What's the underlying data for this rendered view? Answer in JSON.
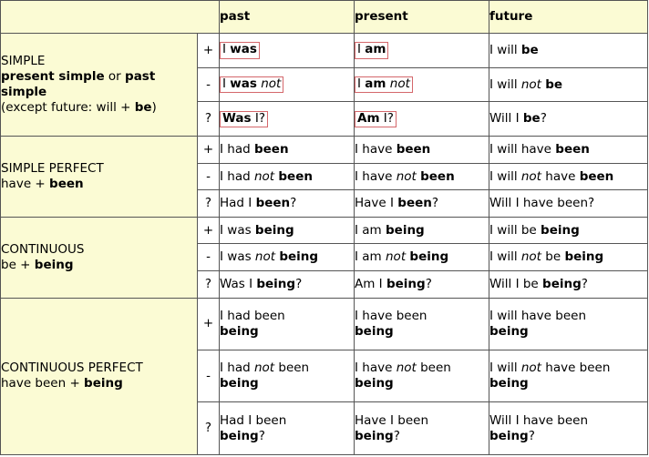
{
  "table": {
    "headers": {
      "blank": "",
      "past": "past",
      "present": "present",
      "future": "future"
    },
    "signs": {
      "positive": "+",
      "negative": "-",
      "question": "?"
    },
    "colors": {
      "header_bg": "#fbfbd4",
      "header_border": "#8a8a4a",
      "label_bg": "#fbfbd4",
      "cell_bg": "#ffffff",
      "grid_border": "#555555",
      "outer_border": "#2b2b2b",
      "highlight_box": "#d4676b",
      "text": "#000000"
    },
    "groups": [
      {
        "title": "SIMPLE",
        "subtitle_parts": [
          {
            "text": "present simple",
            "bold": true
          },
          {
            "text": " or ",
            "bold": false
          },
          {
            "text": "past simple",
            "bold": true
          }
        ],
        "note_parts": [
          {
            "text": "(except future: will + ",
            "bold": false
          },
          {
            "text": "be",
            "bold": true
          },
          {
            "text": ")",
            "bold": false
          }
        ],
        "rows": [
          {
            "sign": "+",
            "past": {
              "boxed": true,
              "parts": [
                {
                  "text": "I ",
                  "bold": false
                },
                {
                  "text": "was",
                  "bold": true
                }
              ]
            },
            "present": {
              "boxed": true,
              "parts": [
                {
                  "text": "I ",
                  "bold": false
                },
                {
                  "text": "am",
                  "bold": true
                }
              ]
            },
            "future": {
              "boxed": false,
              "parts": [
                {
                  "text": "I will ",
                  "bold": false
                },
                {
                  "text": "be",
                  "bold": true
                }
              ]
            }
          },
          {
            "sign": "-",
            "past": {
              "boxed": true,
              "parts": [
                {
                  "text": "I ",
                  "bold": false
                },
                {
                  "text": "was",
                  "bold": true
                },
                {
                  "text": " not",
                  "italic": true
                }
              ]
            },
            "present": {
              "boxed": true,
              "parts": [
                {
                  "text": "I ",
                  "bold": false
                },
                {
                  "text": "am",
                  "bold": true
                },
                {
                  "text": " not",
                  "italic": true
                }
              ]
            },
            "future": {
              "boxed": false,
              "parts": [
                {
                  "text": "I will ",
                  "bold": false
                },
                {
                  "text": "not",
                  "italic": true
                },
                {
                  "text": " ",
                  "bold": false
                },
                {
                  "text": "be",
                  "bold": true
                }
              ]
            }
          },
          {
            "sign": "?",
            "past": {
              "boxed": true,
              "parts": [
                {
                  "text": "Was",
                  "bold": true
                },
                {
                  "text": " I?",
                  "bold": false
                }
              ]
            },
            "present": {
              "boxed": true,
              "parts": [
                {
                  "text": "Am",
                  "bold": true
                },
                {
                  "text": " I?",
                  "bold": false
                }
              ]
            },
            "future": {
              "boxed": false,
              "parts": [
                {
                  "text": "Will I ",
                  "bold": false
                },
                {
                  "text": "be",
                  "bold": true
                },
                {
                  "text": "?",
                  "bold": false
                }
              ]
            }
          }
        ]
      },
      {
        "title": "SIMPLE PERFECT",
        "subtitle_parts": [
          {
            "text": "have + ",
            "bold": false
          },
          {
            "text": "been",
            "bold": true
          }
        ],
        "note_parts": [],
        "rows": [
          {
            "sign": "+",
            "past": {
              "boxed": false,
              "parts": [
                {
                  "text": "I had ",
                  "bold": false
                },
                {
                  "text": "been",
                  "bold": true
                }
              ]
            },
            "present": {
              "boxed": false,
              "parts": [
                {
                  "text": "I have ",
                  "bold": false
                },
                {
                  "text": "been",
                  "bold": true
                }
              ]
            },
            "future": {
              "boxed": false,
              "parts": [
                {
                  "text": "I will have ",
                  "bold": false
                },
                {
                  "text": "been",
                  "bold": true
                }
              ]
            }
          },
          {
            "sign": "-",
            "past": {
              "boxed": false,
              "parts": [
                {
                  "text": "I had ",
                  "bold": false
                },
                {
                  "text": "not",
                  "italic": true
                },
                {
                  "text": " ",
                  "bold": false
                },
                {
                  "text": "been",
                  "bold": true
                }
              ]
            },
            "present": {
              "boxed": false,
              "parts": [
                {
                  "text": "I have ",
                  "bold": false
                },
                {
                  "text": "not",
                  "italic": true
                },
                {
                  "text": " ",
                  "bold": false
                },
                {
                  "text": "been",
                  "bold": true
                }
              ]
            },
            "future": {
              "boxed": false,
              "parts": [
                {
                  "text": "I will ",
                  "bold": false
                },
                {
                  "text": "not",
                  "italic": true
                },
                {
                  "text": " have ",
                  "bold": false
                },
                {
                  "text": "been",
                  "bold": true
                }
              ]
            }
          },
          {
            "sign": "?",
            "past": {
              "boxed": false,
              "parts": [
                {
                  "text": "Had I ",
                  "bold": false
                },
                {
                  "text": "been",
                  "bold": true
                },
                {
                  "text": "?",
                  "bold": false
                }
              ]
            },
            "present": {
              "boxed": false,
              "parts": [
                {
                  "text": "Have I ",
                  "bold": false
                },
                {
                  "text": "been",
                  "bold": true
                },
                {
                  "text": "?",
                  "bold": false
                }
              ]
            },
            "future": {
              "boxed": false,
              "parts": [
                {
                  "text": "Will I have been?",
                  "bold": false
                }
              ]
            }
          }
        ]
      },
      {
        "title": "CONTINUOUS",
        "subtitle_parts": [
          {
            "text": "be + ",
            "bold": false
          },
          {
            "text": "being",
            "bold": true
          }
        ],
        "note_parts": [],
        "rows": [
          {
            "sign": "+",
            "past": {
              "boxed": false,
              "parts": [
                {
                  "text": "I was ",
                  "bold": false
                },
                {
                  "text": "being",
                  "bold": true
                }
              ]
            },
            "present": {
              "boxed": false,
              "parts": [
                {
                  "text": "I am ",
                  "bold": false
                },
                {
                  "text": "being",
                  "bold": true
                }
              ]
            },
            "future": {
              "boxed": false,
              "parts": [
                {
                  "text": "I will be ",
                  "bold": false
                },
                {
                  "text": "being",
                  "bold": true
                }
              ]
            }
          },
          {
            "sign": "-",
            "past": {
              "boxed": false,
              "parts": [
                {
                  "text": "I was ",
                  "bold": false
                },
                {
                  "text": "not",
                  "italic": true
                },
                {
                  "text": " ",
                  "bold": false
                },
                {
                  "text": "being",
                  "bold": true
                }
              ]
            },
            "present": {
              "boxed": false,
              "parts": [
                {
                  "text": "I am ",
                  "bold": false
                },
                {
                  "text": "not",
                  "italic": true
                },
                {
                  "text": " ",
                  "bold": false
                },
                {
                  "text": "being",
                  "bold": true
                }
              ]
            },
            "future": {
              "boxed": false,
              "parts": [
                {
                  "text": "I will ",
                  "bold": false
                },
                {
                  "text": "not",
                  "italic": true
                },
                {
                  "text": " be ",
                  "bold": false
                },
                {
                  "text": "being",
                  "bold": true
                }
              ]
            }
          },
          {
            "sign": "?",
            "past": {
              "boxed": false,
              "parts": [
                {
                  "text": "Was I ",
                  "bold": false
                },
                {
                  "text": "being",
                  "bold": true
                },
                {
                  "text": "?",
                  "bold": false
                }
              ]
            },
            "present": {
              "boxed": false,
              "parts": [
                {
                  "text": "Am I ",
                  "bold": false
                },
                {
                  "text": "being",
                  "bold": true
                },
                {
                  "text": "?",
                  "bold": false
                }
              ]
            },
            "future": {
              "boxed": false,
              "parts": [
                {
                  "text": "Will I be ",
                  "bold": false
                },
                {
                  "text": "being",
                  "bold": true
                },
                {
                  "text": "?",
                  "bold": false
                }
              ]
            }
          }
        ]
      },
      {
        "title": "CONTINUOUS PERFECT",
        "subtitle_parts": [
          {
            "text": "have been + ",
            "bold": false
          },
          {
            "text": "being",
            "bold": true
          }
        ],
        "note_parts": [],
        "rows": [
          {
            "sign": "+",
            "past": {
              "boxed": false,
              "parts": [
                {
                  "text": "I had been",
                  "bold": false
                },
                {
                  "text": "\n",
                  "break": true
                },
                {
                  "text": "being",
                  "bold": true
                }
              ]
            },
            "present": {
              "boxed": false,
              "parts": [
                {
                  "text": "I have been",
                  "bold": false
                },
                {
                  "text": "\n",
                  "break": true
                },
                {
                  "text": "being",
                  "bold": true
                }
              ]
            },
            "future": {
              "boxed": false,
              "parts": [
                {
                  "text": "I will have been",
                  "bold": false
                },
                {
                  "text": "\n",
                  "break": true
                },
                {
                  "text": "being",
                  "bold": true
                }
              ]
            }
          },
          {
            "sign": "-",
            "past": {
              "boxed": false,
              "parts": [
                {
                  "text": "I had ",
                  "bold": false
                },
                {
                  "text": "not",
                  "italic": true
                },
                {
                  "text": " been",
                  "bold": false
                },
                {
                  "text": "\n",
                  "break": true
                },
                {
                  "text": "being",
                  "bold": true
                }
              ]
            },
            "present": {
              "boxed": false,
              "parts": [
                {
                  "text": "I have ",
                  "bold": false
                },
                {
                  "text": "not",
                  "italic": true
                },
                {
                  "text": " been",
                  "bold": false
                },
                {
                  "text": "\n",
                  "break": true
                },
                {
                  "text": "being",
                  "bold": true
                }
              ]
            },
            "future": {
              "boxed": false,
              "parts": [
                {
                  "text": "I will ",
                  "bold": false
                },
                {
                  "text": "not",
                  "italic": true
                },
                {
                  "text": " have been",
                  "bold": false
                },
                {
                  "text": "\n",
                  "break": true
                },
                {
                  "text": "being",
                  "bold": true
                }
              ]
            }
          },
          {
            "sign": "?",
            "past": {
              "boxed": false,
              "parts": [
                {
                  "text": "Had I been",
                  "bold": false
                },
                {
                  "text": "\n",
                  "break": true
                },
                {
                  "text": "being",
                  "bold": true
                },
                {
                  "text": "?",
                  "bold": false
                }
              ]
            },
            "present": {
              "boxed": false,
              "parts": [
                {
                  "text": "Have I been",
                  "bold": false
                },
                {
                  "text": "\n",
                  "break": true
                },
                {
                  "text": "being",
                  "bold": true
                },
                {
                  "text": "?",
                  "bold": false
                }
              ]
            },
            "future": {
              "boxed": false,
              "parts": [
                {
                  "text": "Will I have been",
                  "bold": false
                },
                {
                  "text": "\n",
                  "break": true
                },
                {
                  "text": "being",
                  "bold": true
                },
                {
                  "text": "?",
                  "bold": false
                }
              ]
            }
          }
        ]
      }
    ]
  }
}
